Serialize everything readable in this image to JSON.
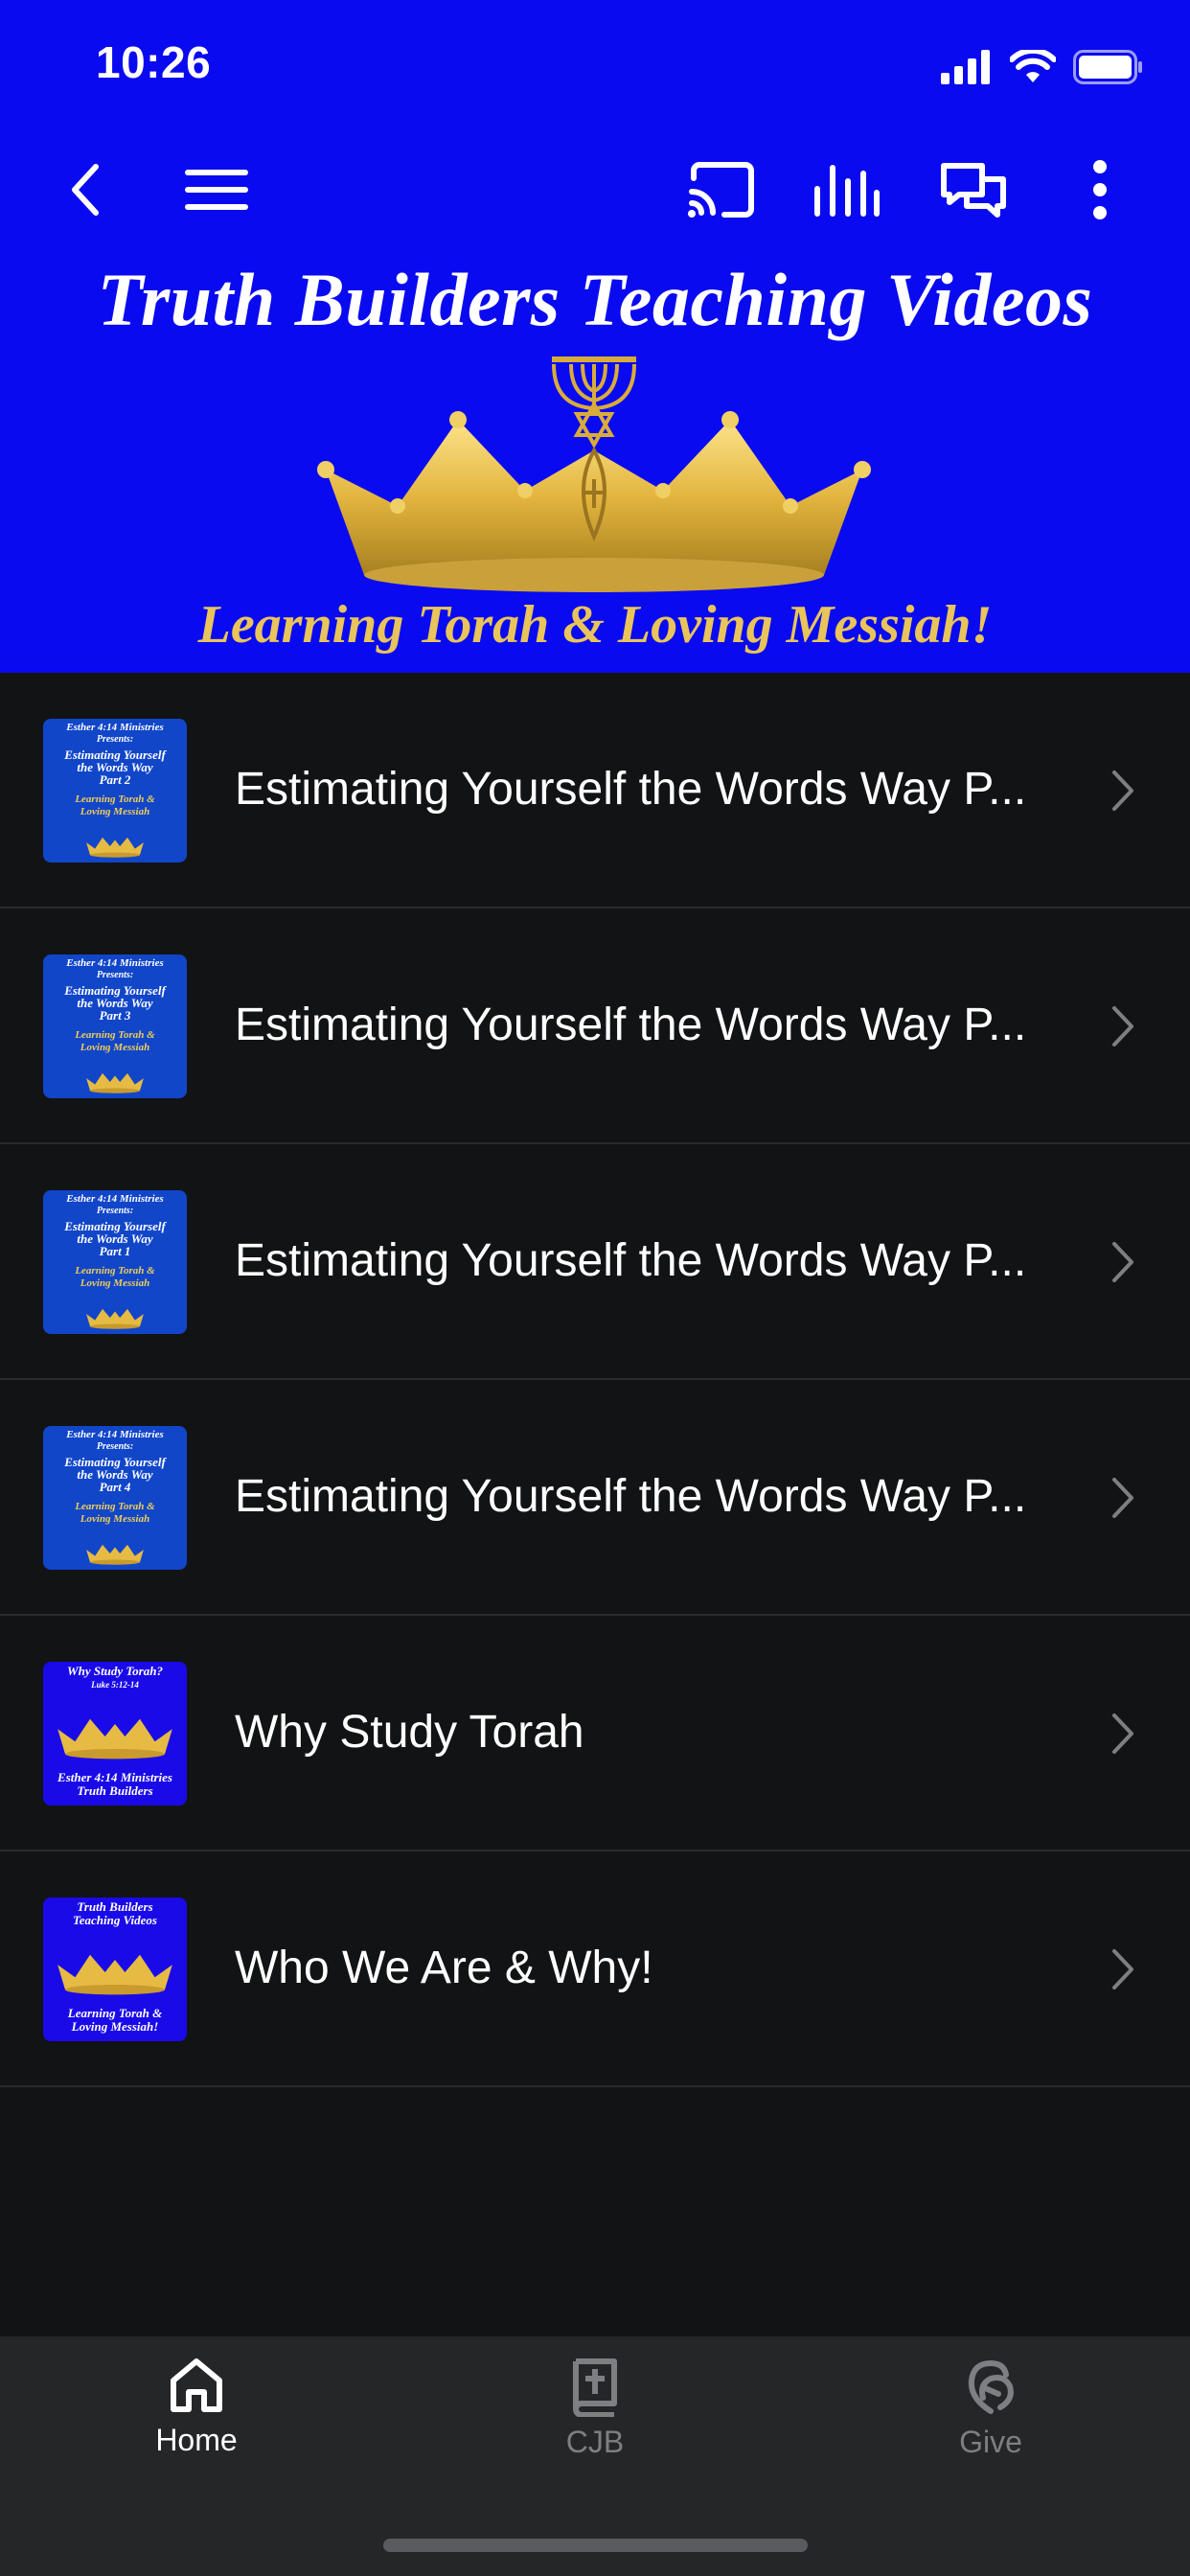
{
  "status_bar": {
    "time": "10:26",
    "signal_icon": "signal-bars-icon",
    "wifi_icon": "wifi-icon",
    "battery_icon": "battery-icon"
  },
  "nav": {
    "back_icon": "chevron-left-icon",
    "menu_icon": "hamburger-menu-icon",
    "cast_icon": "cast-icon",
    "audio_icon": "audio-bars-icon",
    "chat_icon": "chat-bubbles-icon",
    "more_icon": "more-vertical-icon"
  },
  "banner": {
    "title": "Truth Builders Teaching Videos",
    "subtitle": "Learning Torah & Loving Messiah!",
    "colors": {
      "background": "#0a0af0",
      "gold": "#e9c45a"
    }
  },
  "list": {
    "items": [
      {
        "title": "Estimating Yourself the Words Way P...",
        "thumb": {
          "style": "blue",
          "lines": [
            "Esther 4:14 Ministries",
            "Presents:",
            "Estimating Yourself",
            "the Words Way",
            "Part 2",
            "Learning Torah &",
            "Loving Messiah"
          ]
        }
      },
      {
        "title": "Estimating Yourself the Words Way P...",
        "thumb": {
          "style": "blue",
          "lines": [
            "Esther 4:14 Ministries",
            "Presents:",
            "Estimating Yourself",
            "the Words Way",
            "Part 3",
            "Learning Torah &",
            "Loving Messiah"
          ]
        }
      },
      {
        "title": "Estimating Yourself the Words Way P...",
        "thumb": {
          "style": "blue",
          "lines": [
            "Esther 4:14 Ministries",
            "Presents:",
            "Estimating Yourself",
            "the Words Way",
            "Part 1",
            "Learning Torah &",
            "Loving Messiah"
          ]
        }
      },
      {
        "title": "Estimating Yourself the Words Way P...",
        "thumb": {
          "style": "blue",
          "lines": [
            "Esther 4:14 Ministries",
            "Presents:",
            "Estimating Yourself",
            "the Words Way",
            "Part 4",
            "Learning Torah &",
            "Loving Messiah"
          ]
        }
      },
      {
        "title": "Why Study Torah",
        "thumb": {
          "style": "purple",
          "lines": [
            "Why Study Torah?",
            "Luke 5:12-14",
            "Esther 4:14 Ministries",
            "Truth Builders"
          ]
        }
      },
      {
        "title": "Who We Are &  Why!",
        "thumb": {
          "style": "purple",
          "lines": [
            "Truth Builders",
            "Teaching Videos",
            "Learning Torah &",
            "Loving Messiah!"
          ]
        }
      }
    ]
  },
  "tabs": [
    {
      "label": "Home",
      "icon": "home-icon",
      "active": true
    },
    {
      "label": "CJB",
      "icon": "bible-icon",
      "active": false
    },
    {
      "label": "Give",
      "icon": "give-icon",
      "active": false
    }
  ]
}
